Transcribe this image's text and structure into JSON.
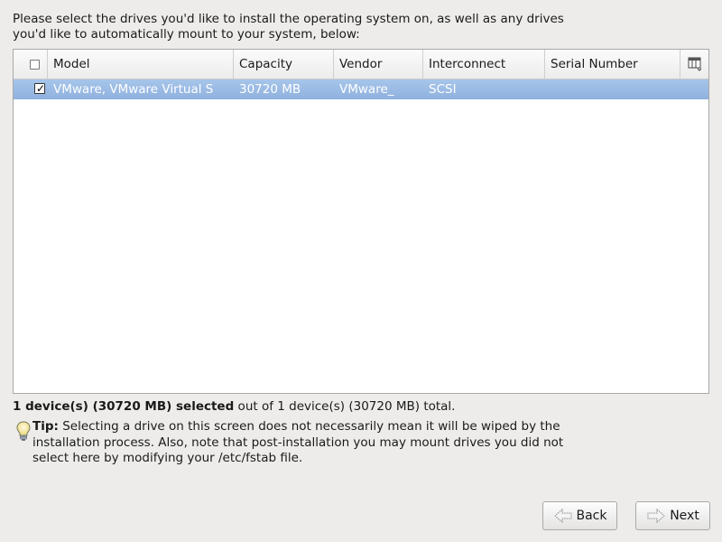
{
  "instructions": {
    "line1": "Please select the drives you'd like to install the operating system on, as well as any drives",
    "line2": "you'd like to automatically mount to your system, below:"
  },
  "table": {
    "columns": {
      "model": "Model",
      "capacity": "Capacity",
      "vendor": "Vendor",
      "interconnect": "Interconnect",
      "serial": "Serial Number"
    },
    "column_picker_icon": "column-picker-icon",
    "rows": [
      {
        "checked": true,
        "model": "VMware, VMware Virtual S",
        "capacity": "30720 MB",
        "vendor": "VMware_",
        "interconnect": "SCSI",
        "serial": ""
      }
    ]
  },
  "summary": {
    "bold_text": "1 device(s) (30720 MB) selected",
    "rest_text": " out of 1 device(s) (30720 MB) total."
  },
  "tip": {
    "icon": "lightbulb-icon",
    "label": "Tip:",
    "line1": " Selecting a drive on this screen does not necessarily mean it will be wiped by the",
    "line2": "installation process.  Also, note that post-installation you may mount drives you did not",
    "line3": "select here by modifying your /etc/fstab file."
  },
  "buttons": {
    "back": "Back",
    "next": "Next"
  },
  "colors": {
    "selection": "#98b8e2",
    "background": "#edeceb"
  }
}
